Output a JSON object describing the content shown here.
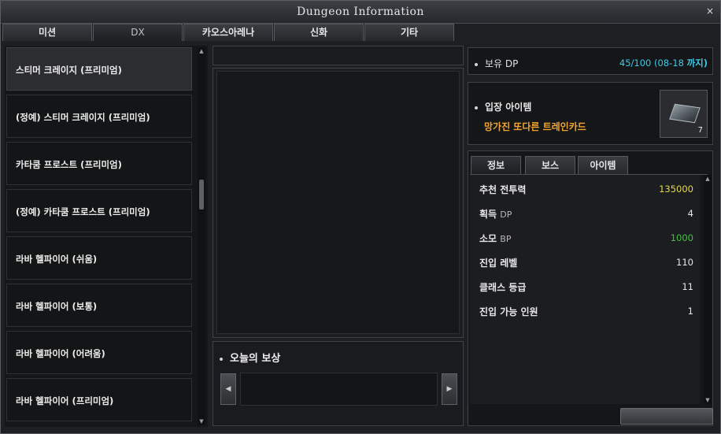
{
  "window": {
    "title": "Dungeon Information",
    "close_glyph": "×"
  },
  "tabs": [
    {
      "label": "미션",
      "active": false
    },
    {
      "label": "DX",
      "active": true
    },
    {
      "label": "카오스아레나",
      "active": false
    },
    {
      "label": "신화",
      "active": false
    },
    {
      "label": "기타",
      "active": false
    }
  ],
  "dungeons": [
    {
      "label": "스티머 크레이지 (프리미엄)",
      "selected": true
    },
    {
      "label": "(정예) 스티머 크레이지 (프리미엄)",
      "selected": false
    },
    {
      "label": "카타쿰 프로스트 (프리미엄)",
      "selected": false
    },
    {
      "label": "(정예) 카타쿰 프로스트 (프리미엄)",
      "selected": false
    },
    {
      "label": "라바 헬파이어 (쉬움)",
      "selected": false
    },
    {
      "label": "라바 헬파이어 (보통)",
      "selected": false
    },
    {
      "label": "라바 헬파이어 (어려움)",
      "selected": false
    },
    {
      "label": "라바 헬파이어 (프리미엄)",
      "selected": false
    }
  ],
  "reward": {
    "title": "오늘의 보상",
    "prev_glyph": "◀",
    "next_glyph": "▶"
  },
  "dp": {
    "label_ko": "보유",
    "label_en": "DP",
    "value": "45/100 (08-18",
    "until": "까지)"
  },
  "entry": {
    "label": "입장 아이템",
    "item_name": "망가진 또다른 트레인카드",
    "item_icon": "train-card-icon",
    "item_count": "7"
  },
  "info_tabs": [
    {
      "label": "정보",
      "active": true
    },
    {
      "label": "보스",
      "active": false
    },
    {
      "label": "아이템",
      "active": false
    }
  ],
  "stats": [
    {
      "label": "추천 전투력",
      "en": "",
      "value": "135000",
      "color": "#e6d84a"
    },
    {
      "label": "획득",
      "en": "DP",
      "value": "4",
      "color": "#e8e8e8"
    },
    {
      "label": "소모",
      "en": "BP",
      "value": "1000",
      "color": "#3fc33f"
    },
    {
      "label": "진입 레벨",
      "en": "",
      "value": "110",
      "color": "#e8e8e8"
    },
    {
      "label": "클래스 등급",
      "en": "",
      "value": "11",
      "color": "#e8e8e8"
    },
    {
      "label": "진입 가능 인원",
      "en": "",
      "value": "1",
      "color": "#e8e8e8"
    }
  ],
  "scroll_glyphs": {
    "up": "▲",
    "down": "▼"
  },
  "colors": {
    "accent_cyan": "#3ec8e6",
    "item_orange": "#f0a531",
    "power_yellow": "#e6d84a",
    "bp_green": "#3fc33f"
  }
}
